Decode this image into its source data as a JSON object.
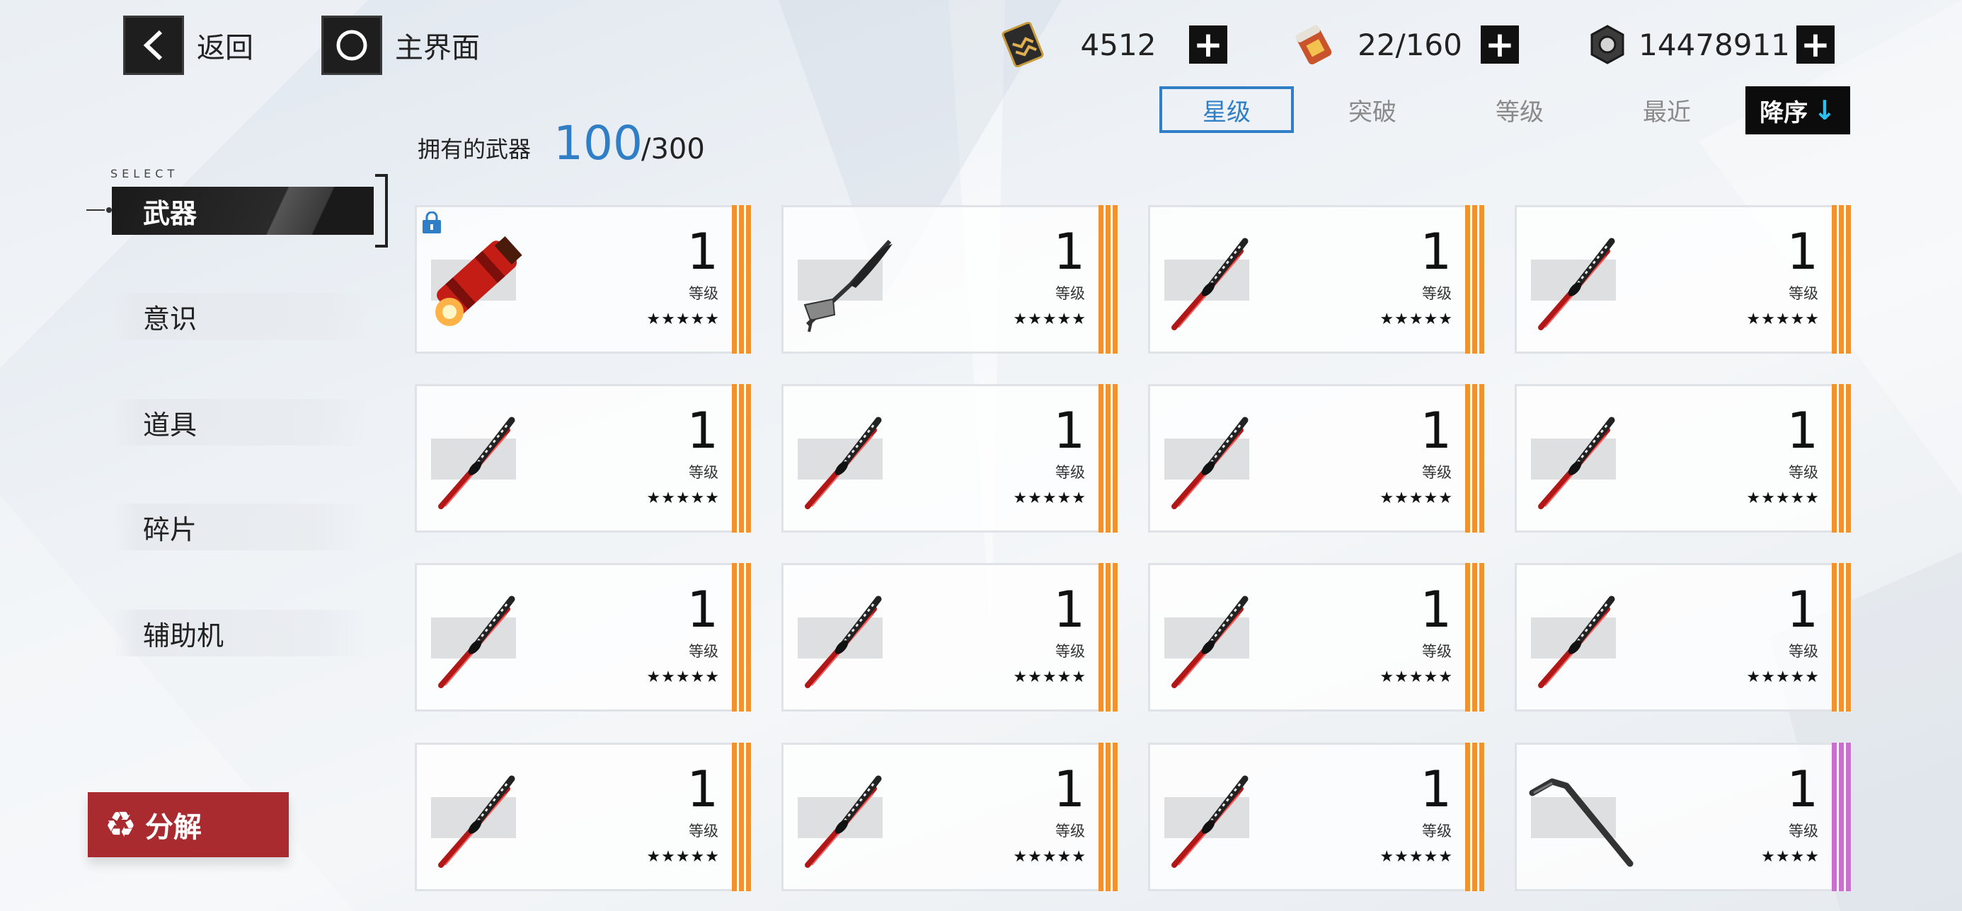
{
  "nav": {
    "back_label": "返回",
    "home_label": "主界面"
  },
  "resources": [
    {
      "icon": "ticket-icon",
      "value": "4512"
    },
    {
      "icon": "battery-icon",
      "value": "22/160"
    },
    {
      "icon": "gear-coin-icon",
      "value": "14478911"
    }
  ],
  "sort": {
    "options": [
      "星级",
      "突破",
      "等级",
      "最近"
    ],
    "active": "星级",
    "order_label": "降序"
  },
  "owned": {
    "label": "拥有的武器",
    "count": "100",
    "max": "/300"
  },
  "sidebar": {
    "select_caption": "SELECT",
    "active": "武器",
    "items": [
      "意识",
      "道具",
      "碎片",
      "辅助机"
    ]
  },
  "decompose_label": "分解",
  "colors": {
    "accent_blue": "#2f7ec6",
    "rarity_orange": "#f2922f",
    "rarity_purple": "#c96fce",
    "decompose_red": "#a92b2f"
  },
  "weapons": [
    {
      "type": "cannon",
      "level": "1",
      "level_label": "等级",
      "stars": "★★★★★",
      "rarity": "orange",
      "locked": true
    },
    {
      "type": "scythe",
      "level": "1",
      "level_label": "等级",
      "stars": "★★★★★",
      "rarity": "orange",
      "locked": false
    },
    {
      "type": "katana",
      "level": "1",
      "level_label": "等级",
      "stars": "★★★★★",
      "rarity": "orange",
      "locked": false
    },
    {
      "type": "katana",
      "level": "1",
      "level_label": "等级",
      "stars": "★★★★★",
      "rarity": "orange",
      "locked": false
    },
    {
      "type": "katana",
      "level": "1",
      "level_label": "等级",
      "stars": "★★★★★",
      "rarity": "orange",
      "locked": false
    },
    {
      "type": "katana",
      "level": "1",
      "level_label": "等级",
      "stars": "★★★★★",
      "rarity": "orange",
      "locked": false
    },
    {
      "type": "katana",
      "level": "1",
      "level_label": "等级",
      "stars": "★★★★★",
      "rarity": "orange",
      "locked": false
    },
    {
      "type": "katana",
      "level": "1",
      "level_label": "等级",
      "stars": "★★★★★",
      "rarity": "orange",
      "locked": false
    },
    {
      "type": "katana",
      "level": "1",
      "level_label": "等级",
      "stars": "★★★★★",
      "rarity": "orange",
      "locked": false
    },
    {
      "type": "katana",
      "level": "1",
      "level_label": "等级",
      "stars": "★★★★★",
      "rarity": "orange",
      "locked": false
    },
    {
      "type": "katana",
      "level": "1",
      "level_label": "等级",
      "stars": "★★★★★",
      "rarity": "orange",
      "locked": false
    },
    {
      "type": "katana",
      "level": "1",
      "level_label": "等级",
      "stars": "★★★★★",
      "rarity": "orange",
      "locked": false
    },
    {
      "type": "katana",
      "level": "1",
      "level_label": "等级",
      "stars": "★★★★★",
      "rarity": "orange",
      "locked": false
    },
    {
      "type": "katana",
      "level": "1",
      "level_label": "等级",
      "stars": "★★★★★",
      "rarity": "orange",
      "locked": false
    },
    {
      "type": "katana",
      "level": "1",
      "level_label": "等级",
      "stars": "★★★★★",
      "rarity": "orange",
      "locked": false
    },
    {
      "type": "crowbar",
      "level": "1",
      "level_label": "等级",
      "stars": "★★★★",
      "rarity": "purple",
      "locked": false
    }
  ]
}
